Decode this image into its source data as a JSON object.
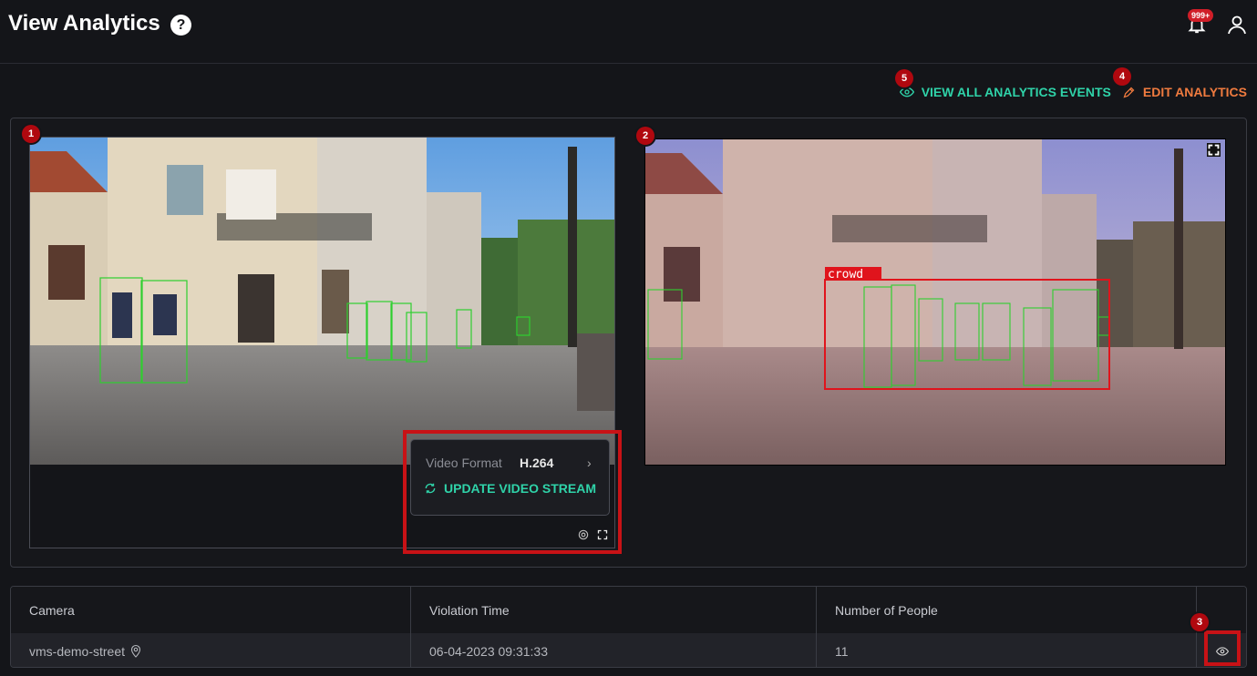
{
  "header": {
    "title": "View Analytics",
    "help_glyph": "?",
    "notification_count": "999+"
  },
  "actions": {
    "view_all_label": "VIEW ALL ANALYTICS EVENTS",
    "edit_label": "EDIT ANALYTICS"
  },
  "badges": [
    "1",
    "2",
    "3",
    "4",
    "5"
  ],
  "video": {
    "format_label": "Video Format",
    "format_value": "H.264",
    "update_label": "UPDATE VIDEO STREAM",
    "crowd_label": "crowd"
  },
  "table": {
    "columns": [
      "Camera",
      "Violation Time",
      "Number of People"
    ],
    "rows": [
      {
        "camera": "vms-demo-street",
        "violation_time": "06-04-2023 09:31:33",
        "people": "11"
      }
    ]
  },
  "colors": {
    "accent_teal": "#2fd3a9",
    "accent_orange": "#f07b3f",
    "badge_red": "#b0080f",
    "detection_green": "#2fcf2f",
    "crowd_red": "#e0141c"
  },
  "icons": [
    "help-icon",
    "bell-icon",
    "user-icon",
    "eye-icon",
    "pencil-icon",
    "refresh-icon",
    "chevron-right-icon",
    "gear-icon",
    "fullscreen-icon",
    "location-pin-icon"
  ]
}
